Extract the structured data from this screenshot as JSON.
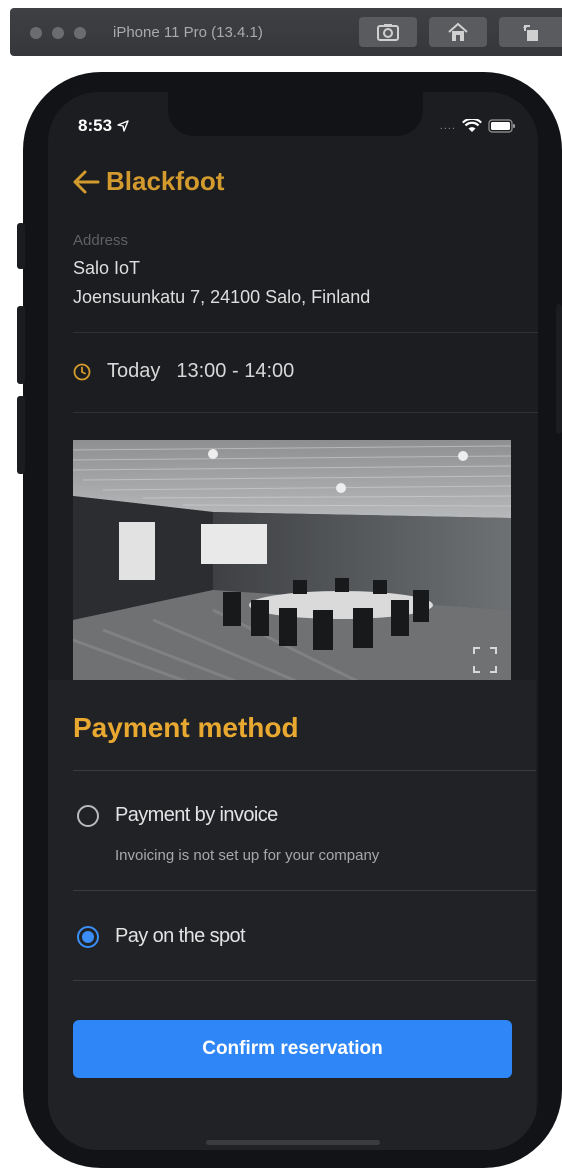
{
  "simulator": {
    "title": "iPhone 11 Pro (13.4.1)",
    "buttons": [
      "screenshot-icon",
      "home-icon",
      "rotate-icon"
    ]
  },
  "status_bar": {
    "time": "8:53",
    "signal": "....",
    "icons": [
      "location-arrow-icon",
      "wifi-icon",
      "battery-icon"
    ]
  },
  "header": {
    "back_icon": "arrow-left-icon",
    "title": "Blackfoot"
  },
  "address": {
    "label": "Address",
    "line1": "Salo IoT",
    "line2": "Joensuunkatu 7, 24100 Salo, Finland"
  },
  "booking": {
    "icon": "clock-icon",
    "day": "Today",
    "time": "13:00 - 14:00"
  },
  "photo": {
    "subject": "meeting room",
    "expand_icon": "fullscreen-icon"
  },
  "payment": {
    "title": "Payment method",
    "options": [
      {
        "label": "Payment by invoice",
        "note": "Invoicing is not set up for your company",
        "selected": false
      },
      {
        "label": "Pay on the spot",
        "note": "",
        "selected": true
      }
    ],
    "confirm_label": "Confirm reservation"
  },
  "colors": {
    "accent": "#d39a2d",
    "sheet_title": "#e9a930",
    "primary_button": "#2f86f6",
    "radio_selected": "#3a8ef5"
  }
}
